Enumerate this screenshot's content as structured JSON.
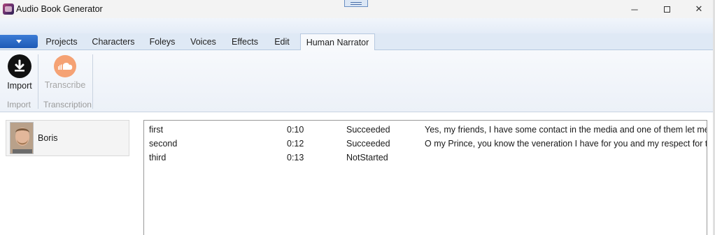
{
  "window": {
    "title": "Audio Book Generator",
    "minimize_glyph": "─",
    "close_glyph": "✕"
  },
  "ribbon": {
    "tabs": [
      {
        "label": "Projects"
      },
      {
        "label": "Characters"
      },
      {
        "label": "Foleys"
      },
      {
        "label": "Voices"
      },
      {
        "label": "Effects"
      },
      {
        "label": "Edit"
      },
      {
        "label": "Human Narrator",
        "active": true
      }
    ],
    "import_button": {
      "label": "Import",
      "icon": "download-icon"
    },
    "transcribe_button": {
      "label": "Transcribe",
      "icon": "soundcloud-icon",
      "disabled": true
    },
    "groups": {
      "import": "Import",
      "transcription": "Transcription"
    }
  },
  "narrators": [
    {
      "name": "Boris"
    }
  ],
  "recordings": [
    {
      "name": "first",
      "duration": "0:10",
      "status": "Succeeded",
      "text": "Yes, my friends, I have some contact in the media and one of them let me knc"
    },
    {
      "name": "second",
      "duration": "0:12",
      "status": "Succeeded",
      "text": "O my Prince, you know the veneration I have for you and my respect for the i"
    },
    {
      "name": "third",
      "duration": "0:13",
      "status": "NotStarted",
      "text": ""
    }
  ],
  "colors": {
    "accent": "#1d5ab6",
    "ribbon_bg": "#dfe9f5",
    "soundcloud": "#f5a274"
  }
}
